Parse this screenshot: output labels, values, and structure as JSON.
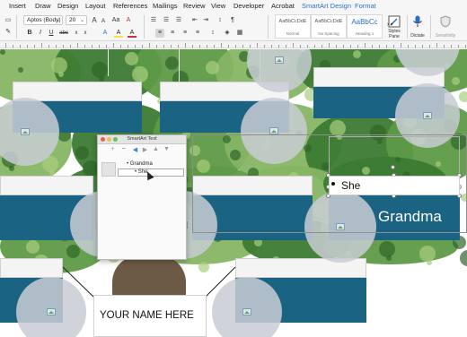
{
  "menu": {
    "tabs": [
      {
        "label": "Insert",
        "color": "#222222"
      },
      {
        "label": "Draw",
        "color": "#222222"
      },
      {
        "label": "Design",
        "color": "#222222"
      },
      {
        "label": "Layout",
        "color": "#222222"
      },
      {
        "label": "References",
        "color": "#222222"
      },
      {
        "label": "Mailings",
        "color": "#222222"
      },
      {
        "label": "Review",
        "color": "#222222"
      },
      {
        "label": "View",
        "color": "#222222"
      },
      {
        "label": "Developer",
        "color": "#222222"
      },
      {
        "label": "Acrobat",
        "color": "#222222"
      },
      {
        "label": "SmartArt Design",
        "color": "#2b6fd6"
      },
      {
        "label": "Format",
        "color": "#2b6fd6"
      }
    ]
  },
  "ribbon": {
    "font_name": "Aptos (Body)",
    "font_size": "20",
    "styles": [
      {
        "sample": "AaBbCcDdE",
        "name": "Normal"
      },
      {
        "sample": "AaBbCcDdE",
        "name": "No Spacing"
      },
      {
        "sample": "AaBbCc",
        "name": "Heading 1"
      }
    ],
    "styles_pane": "Styles\nPane",
    "dictate": "Dictate",
    "sensitivity": "Sensitivity",
    "bold": "B",
    "italic": "I",
    "underline": "U",
    "strike": "abc",
    "sub": "x",
    "sup": "x",
    "font_color": "A",
    "highlight": "A",
    "para": "¶"
  },
  "smartart_pane": {
    "title": "SmartArt Text",
    "items": [
      {
        "label": "Grandma",
        "level": 1
      },
      {
        "label": "She",
        "level": 2
      }
    ]
  },
  "canvas": {
    "she_label": "She",
    "grandma_label": "Grandma",
    "your_name_label": "YOUR NAME HERE"
  },
  "colors": {
    "panel": "#1b6382",
    "accent": "#2b6fd6",
    "leaf_dark": "#3c7a33",
    "leaf_light": "#86b564"
  }
}
